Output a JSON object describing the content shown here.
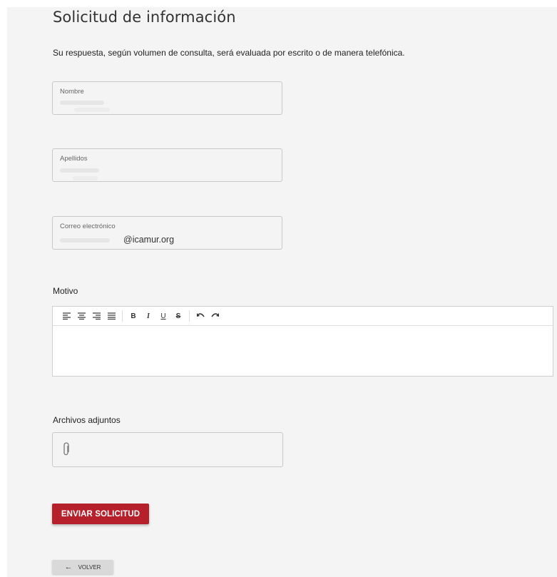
{
  "form": {
    "title": "Solicitud de información",
    "subtitle": "Su respuesta, según volumen de consulta, será evaluada por escrito o de manera telefónica."
  },
  "fields": {
    "nombre": {
      "label": "Nombre",
      "value": ""
    },
    "apellidos": {
      "label": "Apellidos",
      "value": ""
    },
    "correo": {
      "label": "Correo electrónico",
      "value": "@icamur.org"
    }
  },
  "motivo": {
    "label": "Motivo",
    "toolbar": [
      {
        "name": "align-left-icon",
        "glyph": "≣"
      },
      {
        "name": "align-center-icon",
        "glyph": "≣"
      },
      {
        "name": "align-right-icon",
        "glyph": "≣"
      },
      {
        "name": "align-justify-icon",
        "glyph": "≣"
      },
      {
        "name": "bold-icon",
        "glyph": "B"
      },
      {
        "name": "italic-icon",
        "glyph": "I"
      },
      {
        "name": "underline-icon",
        "glyph": "U"
      },
      {
        "name": "strikethrough-icon",
        "glyph": "S"
      },
      {
        "name": "undo-icon",
        "glyph": "↶"
      },
      {
        "name": "redo-icon",
        "glyph": "↷"
      }
    ]
  },
  "attachments": {
    "label": "Archivos adjuntos",
    "icon": "paperclip-icon"
  },
  "actions": {
    "submit_label": "ENVIAR SOLICITUD",
    "back_label": "VOLVER",
    "back_icon": "arrow-left-icon"
  },
  "colors": {
    "primary": "#b5202a",
    "background": "#f4f4f4",
    "back_button": "#d9d9d9"
  }
}
